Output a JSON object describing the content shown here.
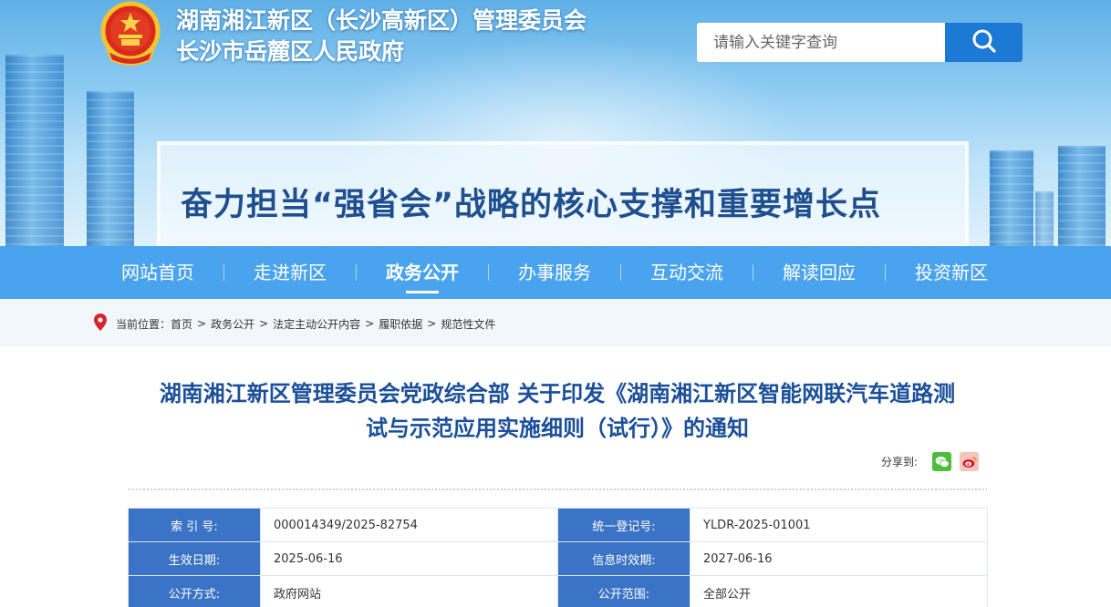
{
  "header": {
    "title_line1": "湖南湘江新区（长沙高新区）管理委员会",
    "title_line2": "长沙市岳麓区人民政府",
    "slogan": "奋力担当“强省会”战略的核心支撑和重要增长点",
    "search_placeholder": "请输入关键字查询"
  },
  "nav": {
    "items": [
      {
        "label": "网站首页",
        "active": false
      },
      {
        "label": "走进新区",
        "active": false
      },
      {
        "label": "政务公开",
        "active": true
      },
      {
        "label": "办事服务",
        "active": false
      },
      {
        "label": "互动交流",
        "active": false
      },
      {
        "label": "解读回应",
        "active": false
      },
      {
        "label": "投资新区",
        "active": false
      }
    ]
  },
  "breadcrumb": {
    "prefix": "当前位置：",
    "items": [
      "首页",
      "政务公开",
      "法定主动公开内容",
      "履职依据",
      "规范性文件"
    ],
    "separator": ">"
  },
  "article": {
    "title_line1": "湖南湘江新区管理委员会党政综合部 关于印发《湖南湘江新区智能网联汽车道路测",
    "title_line2": "试与示范应用实施细则（试行）》的通知",
    "share_label": "分享到:"
  },
  "meta": {
    "rows": [
      {
        "label1": "索 引 号:",
        "value1": "000014349/2025-82754",
        "label2": "统一登记号:",
        "value2": "YLDR-2025-01001"
      },
      {
        "label1": "生效日期:",
        "value1": "2025-06-16",
        "label2": "信息时效期:",
        "value2": "2027-06-16"
      },
      {
        "label1": "公开方式:",
        "value1": "政府网站",
        "label2": "公开范围:",
        "value2": "全部公开"
      }
    ]
  },
  "colors": {
    "nav_bg": "#4aa3ef",
    "search_button": "#1d7ad4",
    "title": "#1b4f9a",
    "meta_label_bg": "#3b73c6",
    "breadcrumb_bg": "#f2f7fc"
  },
  "icons": {
    "emblem": "national-emblem-icon",
    "search": "search-icon",
    "location": "location-pin-icon",
    "wechat": "wechat-icon",
    "weibo": "weibo-icon"
  }
}
